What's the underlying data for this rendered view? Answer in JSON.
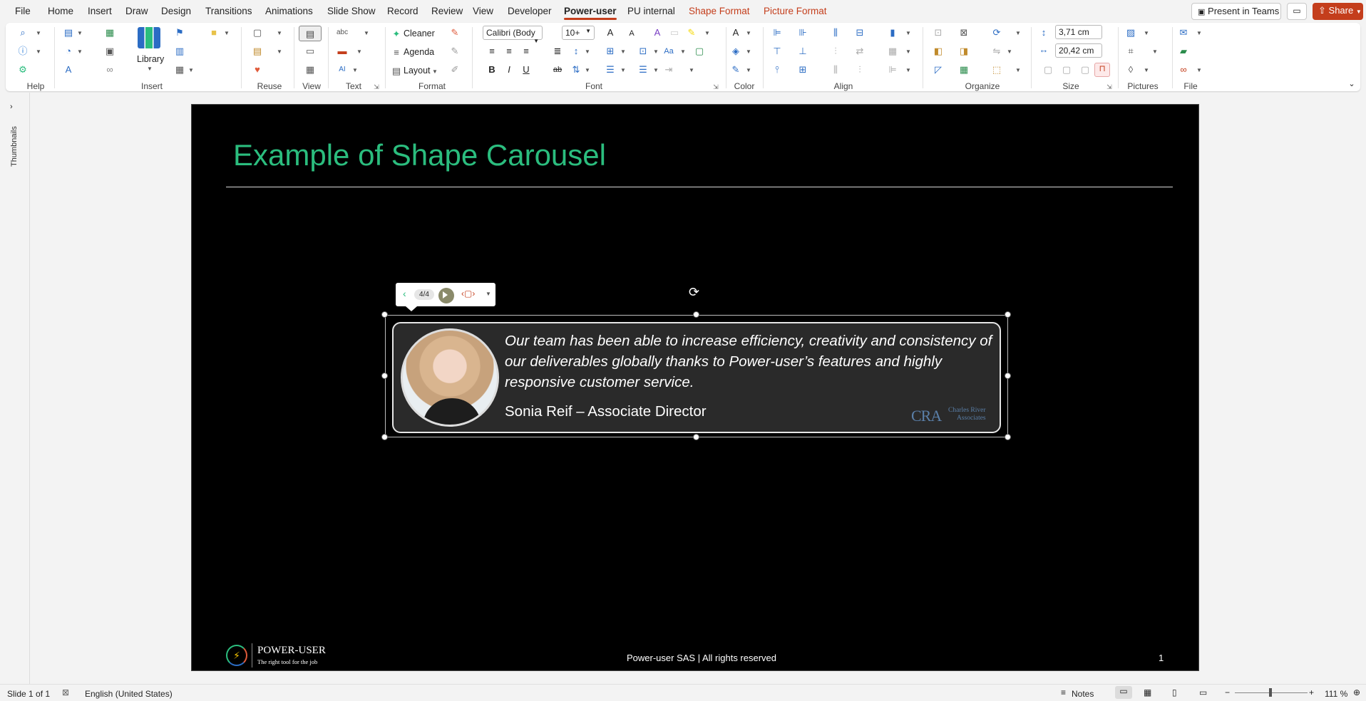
{
  "menu": {
    "tabs": [
      "File",
      "Home",
      "Insert",
      "Draw",
      "Design",
      "Transitions",
      "Animations",
      "Slide Show",
      "Record",
      "Review",
      "View",
      "Developer",
      "Power-user",
      "PU internal",
      "Shape Format",
      "Picture Format"
    ],
    "present_label": "Present in Teams",
    "share_label": "Share"
  },
  "ribbon": {
    "groups": {
      "help": "Help",
      "insert": "Insert",
      "reuse": "Reuse",
      "view": "View",
      "text": "Text",
      "format": "Format",
      "font": "Font",
      "color": "Color",
      "align": "Align",
      "organize": "Organize",
      "size": "Size",
      "pictures": "Pictures",
      "file": "File"
    },
    "library_label": "Library",
    "cleaner_label": "Cleaner",
    "agenda_label": "Agenda",
    "layout_label": "Layout",
    "font_name": "Calibri (Body",
    "font_size": "10+",
    "height_value": "3,71 cm",
    "width_value": "20,42 cm",
    "bold": "B",
    "italic": "I",
    "underline": "U"
  },
  "left_pane": {
    "label": "Thumbnails"
  },
  "slide": {
    "title": "Example of Shape Carousel",
    "quote": "Our team has been able to increase efficiency, creativity and consistency of our deliverables globally thanks to Power-user’s features and highly responsive customer service.",
    "author": "Sonia Reif – Associate Director",
    "cra_initials": "CRA",
    "cra_name_line1": "Charles River",
    "cra_name_line2": "Associates",
    "footer": "Power-user SAS | All rights reserved",
    "page_number": "1",
    "logo_name": "POWER-USER",
    "logo_tagline": "The right tool for the job"
  },
  "carousel": {
    "counter": "4/4"
  },
  "status": {
    "slide_info": "Slide 1 of 1",
    "language": "English (United States)",
    "notes_label": "Notes",
    "zoom": "111 %"
  },
  "colors": {
    "accent": "#c43e1c",
    "title_green": "#2bbd7e",
    "slide_bg": "#000000"
  }
}
